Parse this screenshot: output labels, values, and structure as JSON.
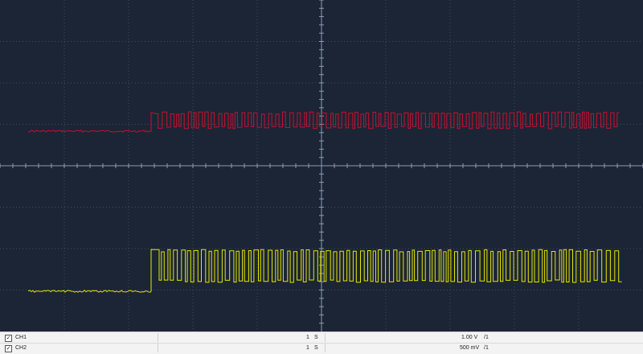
{
  "window": {
    "background": "#1b2536",
    "grid_color": "#3e4d66"
  },
  "channels": [
    {
      "name": "CH1",
      "checked": true,
      "time_base": "1",
      "time_unit": "S",
      "volts_div": "1.00 V",
      "probe": "/1",
      "color": "#c8102e"
    },
    {
      "name": "CH2",
      "checked": true,
      "time_base": "1",
      "time_unit": "S",
      "volts_div": "500 mV",
      "probe": "/1",
      "color": "#e6e600"
    }
  ],
  "icons": {
    "checkbox": "check-icon"
  }
}
